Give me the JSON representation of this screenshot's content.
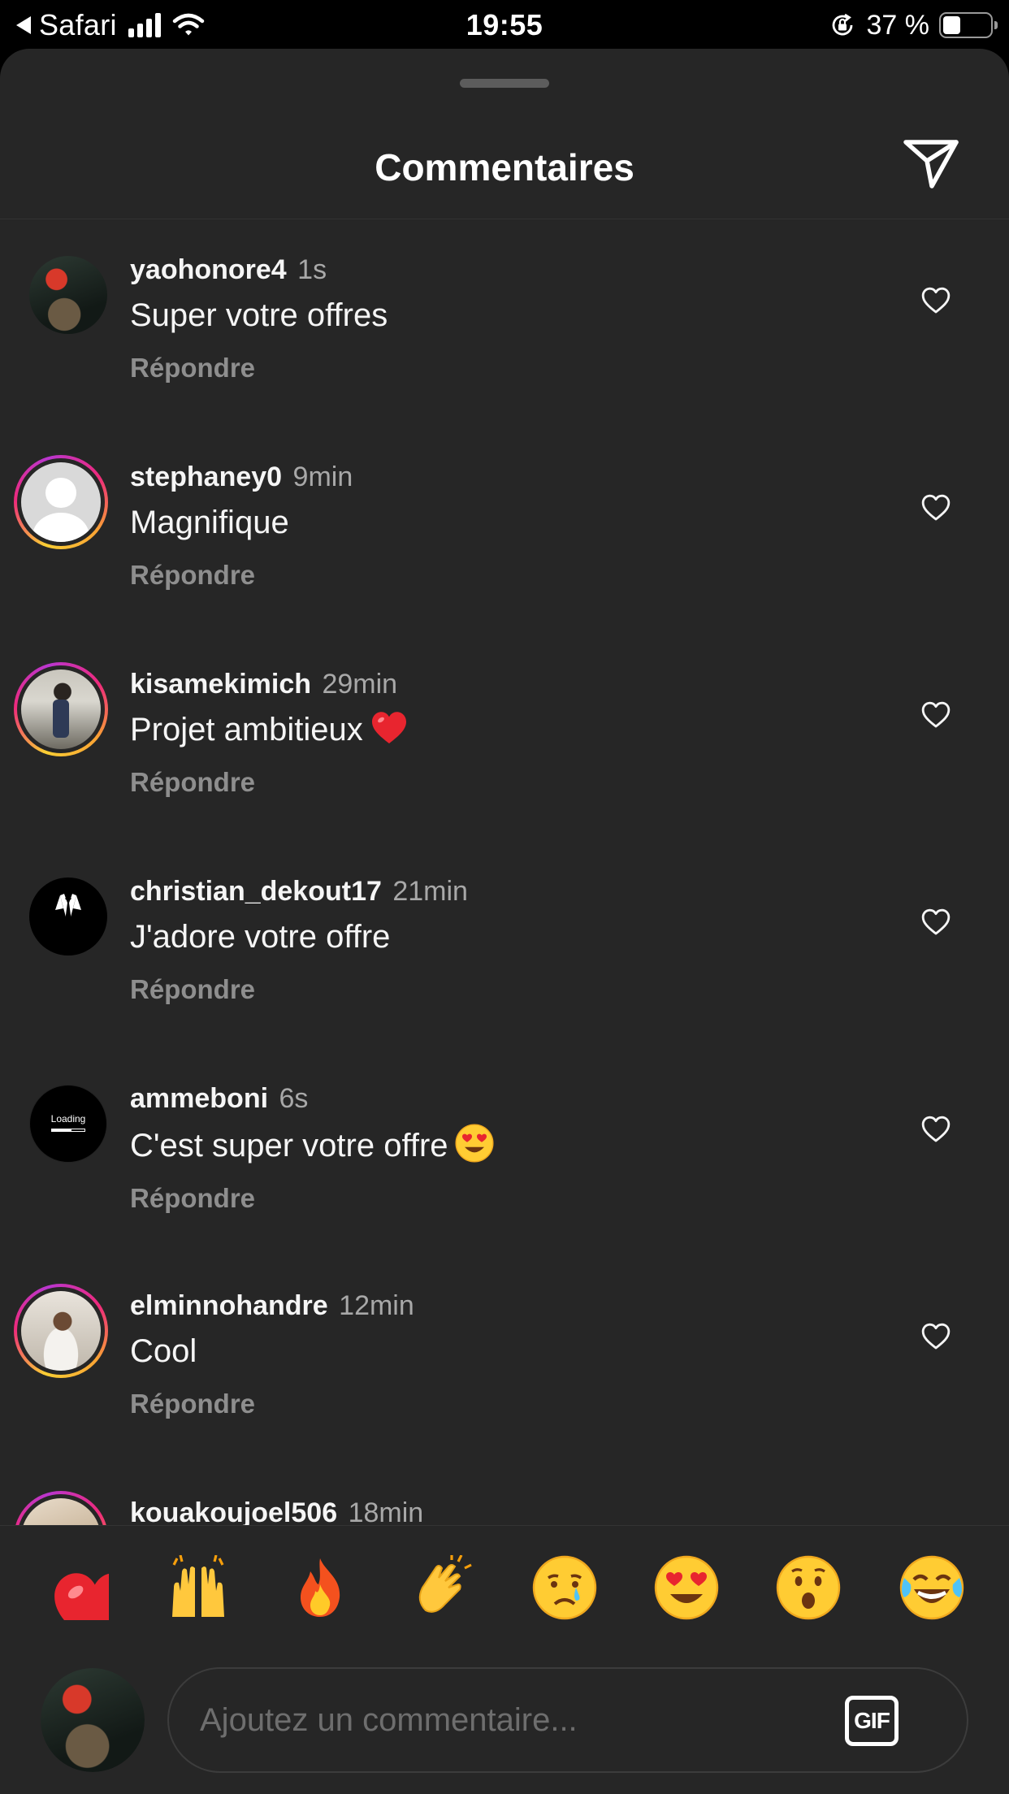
{
  "status_bar": {
    "back_app": "Safari",
    "time": "19:55",
    "battery": "37 %",
    "battery_level": 0.37
  },
  "sheet": {
    "title": "Commentaires",
    "share_icon": "paper-plane-icon"
  },
  "comments": [
    {
      "username": "yaohonore4",
      "time": "1s",
      "text": "Super votre offres",
      "emoji": "",
      "reply": "Répondre",
      "story_ring": false,
      "avatar": "photo"
    },
    {
      "username": "stephaney0",
      "time": "9min",
      "text": "Magnifique",
      "emoji": "",
      "reply": "Répondre",
      "story_ring": true,
      "avatar": "default-avatar"
    },
    {
      "username": "kisamekimich",
      "time": "29min",
      "text": "Projet ambitieux",
      "emoji": "red-heart",
      "reply": "Répondre",
      "story_ring": true,
      "avatar": "photo"
    },
    {
      "username": "christian_dekout17",
      "time": "21min",
      "text": "J'adore votre offre",
      "emoji": "",
      "reply": "Répondre",
      "story_ring": false,
      "avatar": "tuxedo"
    },
    {
      "username": "ammeboni",
      "time": "6s",
      "text": "C'est super votre offre",
      "emoji": "heart-eyes",
      "reply": "Répondre",
      "story_ring": false,
      "avatar": "loading",
      "avatar_text": "Loading"
    },
    {
      "username": "elminnohandre",
      "time": "12min",
      "text": "Cool",
      "emoji": "",
      "reply": "Répondre",
      "story_ring": true,
      "avatar": "photo"
    },
    {
      "username": "kouakoujoel506",
      "time": "18min",
      "text": "",
      "emoji": "",
      "reply": "",
      "story_ring": true,
      "avatar": "photo"
    }
  ],
  "reactions": [
    "red-heart",
    "raising-hands",
    "fire",
    "clapping-hands",
    "crying-face",
    "heart-eyes",
    "surprised-face",
    "tears-of-joy"
  ],
  "composer": {
    "placeholder": "Ajoutez un commentaire...",
    "gif_label": "GIF"
  },
  "colors": {
    "sheet_bg": "#262626",
    "muted": "#8e8e8e",
    "story_ring": [
      "#f9ce34",
      "#ee2a7b",
      "#6228d7"
    ]
  }
}
